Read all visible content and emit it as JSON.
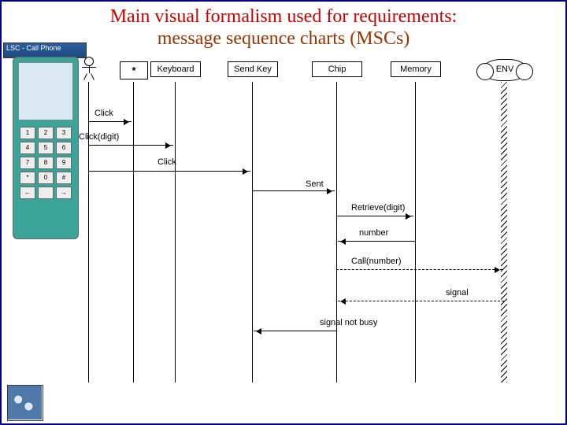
{
  "title": {
    "line1": "Main visual formalism used for requirements:",
    "line2": "message sequence charts (MSCs)"
  },
  "phone_title": "LSC - Call Phone",
  "phone_keys": [
    "1",
    "2",
    "3",
    "4",
    "5",
    "6",
    "7",
    "8",
    "9",
    "*",
    "0",
    "#",
    "←",
    "",
    "→"
  ],
  "participants": {
    "user": "*",
    "keyboard": "Keyboard",
    "sendkey": "Send Key",
    "chip": "Chip",
    "memory": "Memory",
    "env": "ENV"
  },
  "messages": {
    "m1": "Click",
    "m2": "Click(digit)",
    "m3": "Click",
    "m4": "Sent",
    "m5": "Retrieve(digit)",
    "m6": "number",
    "m7": "Call(number)",
    "m8": "signal",
    "m9": "signal not busy"
  },
  "positions": {
    "user": 110,
    "keyboard": 220,
    "sendkey": 318,
    "chip": 425,
    "memory": 525,
    "env": 638
  }
}
